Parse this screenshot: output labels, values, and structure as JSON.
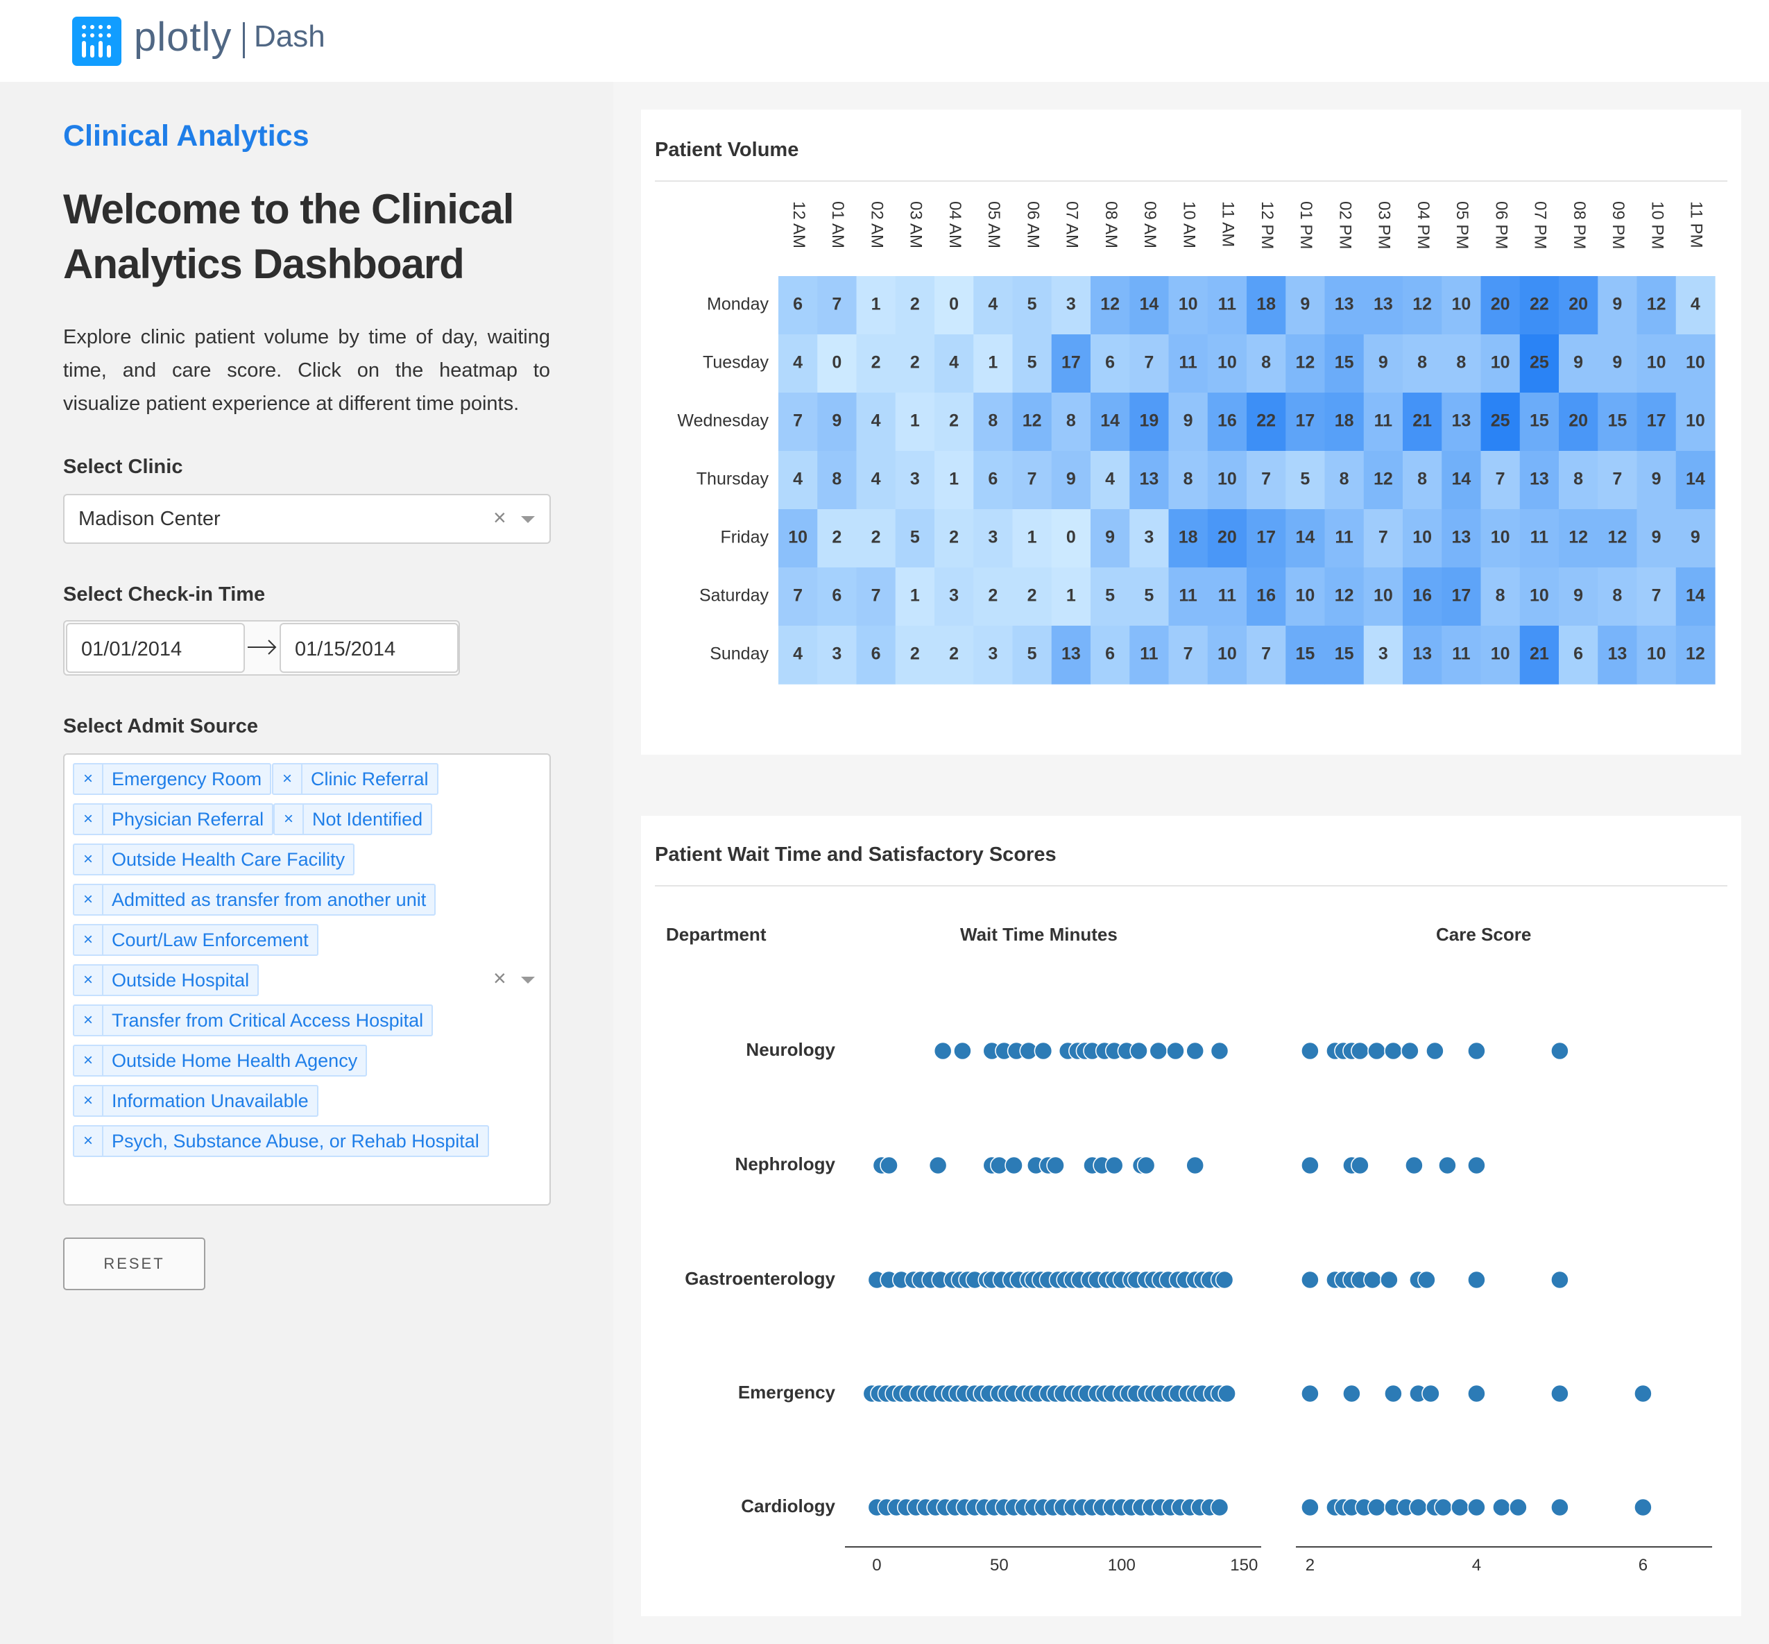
{
  "app": {
    "logo_word": "plotly",
    "logo_product": "Dash"
  },
  "sidebar": {
    "brand": "Clinical Analytics",
    "welcome": "Welcome to the Clinical Analytics Dashboard",
    "intro": "Explore clinic patient volume by time of day, waiting time, and care score. Click on the heatmap to visualize patient experience at different time points.",
    "clinic": {
      "label": "Select Clinic",
      "value": "Madison Center"
    },
    "checkin": {
      "label": "Select Check-in Time",
      "start": "01/01/2014",
      "end": "01/15/2014"
    },
    "admit": {
      "label": "Select Admit Source",
      "sources": [
        "Emergency Room",
        "Clinic Referral",
        "Physician Referral",
        "Not Identified",
        "Outside Health Care Facility",
        "Admitted as transfer from another unit",
        "Court/Law Enforcement",
        "Outside Hospital",
        "Transfer from Critical Access Hospital",
        "Outside Home Health Agency",
        "Information Unavailable",
        "Psych, Substance Abuse, or Rehab Hospital"
      ]
    },
    "reset_label": "RESET"
  },
  "volume_card": {
    "title": "Patient Volume"
  },
  "wait_card": {
    "title": "Patient Wait Time and Satisfactory Scores",
    "col_department": "Department",
    "col_wait": "Wait Time Minutes",
    "col_care": "Care Score"
  },
  "colors": {
    "accent": "#1f7ee8",
    "marker": "#2c7bb6",
    "heat_low": "#cce9ff",
    "heat_high": "#2a83f5"
  },
  "chart_data": [
    {
      "type": "heatmap",
      "title": "Patient Volume",
      "x": [
        "12 AM",
        "01 AM",
        "02 AM",
        "03 AM",
        "04 AM",
        "05 AM",
        "06 AM",
        "07 AM",
        "08 AM",
        "09 AM",
        "10 AM",
        "11 AM",
        "12 PM",
        "01 PM",
        "02 PM",
        "03 PM",
        "04 PM",
        "05 PM",
        "06 PM",
        "07 PM",
        "08 PM",
        "09 PM",
        "10 PM",
        "11 PM"
      ],
      "y": [
        "Monday",
        "Tuesday",
        "Wednesday",
        "Thursday",
        "Friday",
        "Saturday",
        "Sunday"
      ],
      "z": [
        [
          6,
          7,
          1,
          2,
          0,
          4,
          5,
          3,
          12,
          14,
          10,
          11,
          18,
          9,
          13,
          13,
          12,
          10,
          20,
          22,
          20,
          9,
          12,
          4
        ],
        [
          4,
          0,
          2,
          2,
          4,
          1,
          5,
          17,
          6,
          7,
          11,
          10,
          8,
          12,
          15,
          9,
          8,
          8,
          10,
          25,
          9,
          9,
          10,
          10
        ],
        [
          7,
          9,
          4,
          1,
          2,
          8,
          12,
          8,
          14,
          19,
          9,
          16,
          22,
          17,
          18,
          11,
          21,
          13,
          25,
          15,
          20,
          15,
          17,
          10
        ],
        [
          4,
          8,
          4,
          3,
          1,
          6,
          7,
          9,
          4,
          13,
          8,
          10,
          7,
          5,
          8,
          12,
          8,
          14,
          7,
          13,
          8,
          7,
          9,
          14
        ],
        [
          10,
          2,
          2,
          5,
          2,
          3,
          1,
          0,
          9,
          3,
          18,
          20,
          17,
          14,
          11,
          7,
          10,
          13,
          10,
          11,
          12,
          12,
          9,
          9
        ],
        [
          7,
          6,
          7,
          1,
          3,
          2,
          2,
          1,
          5,
          5,
          11,
          11,
          16,
          10,
          12,
          10,
          16,
          17,
          8,
          10,
          9,
          8,
          7,
          14
        ],
        [
          4,
          3,
          6,
          2,
          2,
          3,
          5,
          13,
          6,
          11,
          7,
          10,
          7,
          15,
          15,
          3,
          13,
          11,
          10,
          21,
          6,
          13,
          10,
          12
        ]
      ],
      "colorscale": [
        "#cce9ff",
        "#2a83f5"
      ]
    },
    {
      "type": "scatter",
      "title": "Wait Time Minutes",
      "categories": [
        "Neurology",
        "Nephrology",
        "Gastroenterology",
        "Emergency",
        "Cardiology"
      ],
      "xlim": [
        -13,
        157
      ],
      "xticks": [
        0,
        50,
        100,
        150
      ],
      "series": [
        {
          "name": "Neurology",
          "values": [
            27,
            35,
            47,
            52,
            57,
            62,
            68,
            78,
            82,
            85,
            88,
            93,
            97,
            102,
            107,
            115,
            122,
            130,
            140
          ]
        },
        {
          "name": "Nephrology",
          "values": [
            2,
            5,
            25,
            47,
            50,
            56,
            65,
            70,
            73,
            88,
            92,
            97,
            108,
            110,
            130
          ]
        },
        {
          "name": "Gastroenterology",
          "values": [
            0,
            5,
            10,
            15,
            18,
            22,
            26,
            31,
            34,
            37,
            40,
            45,
            47,
            51,
            55,
            58,
            62,
            64,
            67,
            70,
            74,
            77,
            80,
            83,
            87,
            90,
            94,
            97,
            100,
            104,
            106,
            110,
            113,
            116,
            119,
            123,
            126,
            130,
            133,
            136,
            140,
            142
          ]
        },
        {
          "name": "Emergency",
          "values": [
            -2,
            1,
            4,
            7,
            10,
            13,
            17,
            20,
            23,
            27,
            30,
            33,
            36,
            40,
            43,
            46,
            50,
            53,
            56,
            60,
            63,
            66,
            70,
            73,
            76,
            80,
            83,
            86,
            90,
            93,
            96,
            100,
            103,
            106,
            110,
            113,
            116,
            120,
            123,
            127,
            130,
            133,
            137,
            140,
            143
          ]
        },
        {
          "name": "Cardiology",
          "values": [
            0,
            4,
            8,
            12,
            16,
            20,
            24,
            28,
            32,
            36,
            40,
            44,
            48,
            52,
            56,
            60,
            64,
            68,
            72,
            76,
            80,
            84,
            88,
            92,
            96,
            100,
            104,
            108,
            112,
            116,
            120,
            124,
            128,
            132,
            136,
            140
          ]
        }
      ]
    },
    {
      "type": "scatter",
      "title": "Care Score",
      "categories": [
        "Neurology",
        "Nephrology",
        "Gastroenterology",
        "Emergency",
        "Cardiology"
      ],
      "xlim": [
        1.83,
        6.83
      ],
      "xticks": [
        2,
        4,
        6
      ],
      "series": [
        {
          "name": "Neurology",
          "values": [
            2,
            2.3,
            2.4,
            2.5,
            2.6,
            2.8,
            3,
            3.2,
            3.5,
            4,
            5
          ]
        },
        {
          "name": "Nephrology",
          "values": [
            2,
            2.5,
            2.6,
            3.25,
            3.65,
            4
          ]
        },
        {
          "name": "Gastroenterology",
          "values": [
            2,
            2.3,
            2.4,
            2.5,
            2.6,
            2.75,
            2.95,
            3.3,
            3.4,
            4,
            5
          ]
        },
        {
          "name": "Emergency",
          "values": [
            2,
            2.5,
            3,
            3.3,
            3.45,
            4,
            5,
            6
          ]
        },
        {
          "name": "Cardiology",
          "values": [
            2,
            2.3,
            2.4,
            2.5,
            2.65,
            2.8,
            3,
            3.15,
            3.3,
            3.5,
            3.6,
            3.8,
            4,
            4.3,
            4.5,
            5,
            6
          ]
        }
      ]
    }
  ]
}
